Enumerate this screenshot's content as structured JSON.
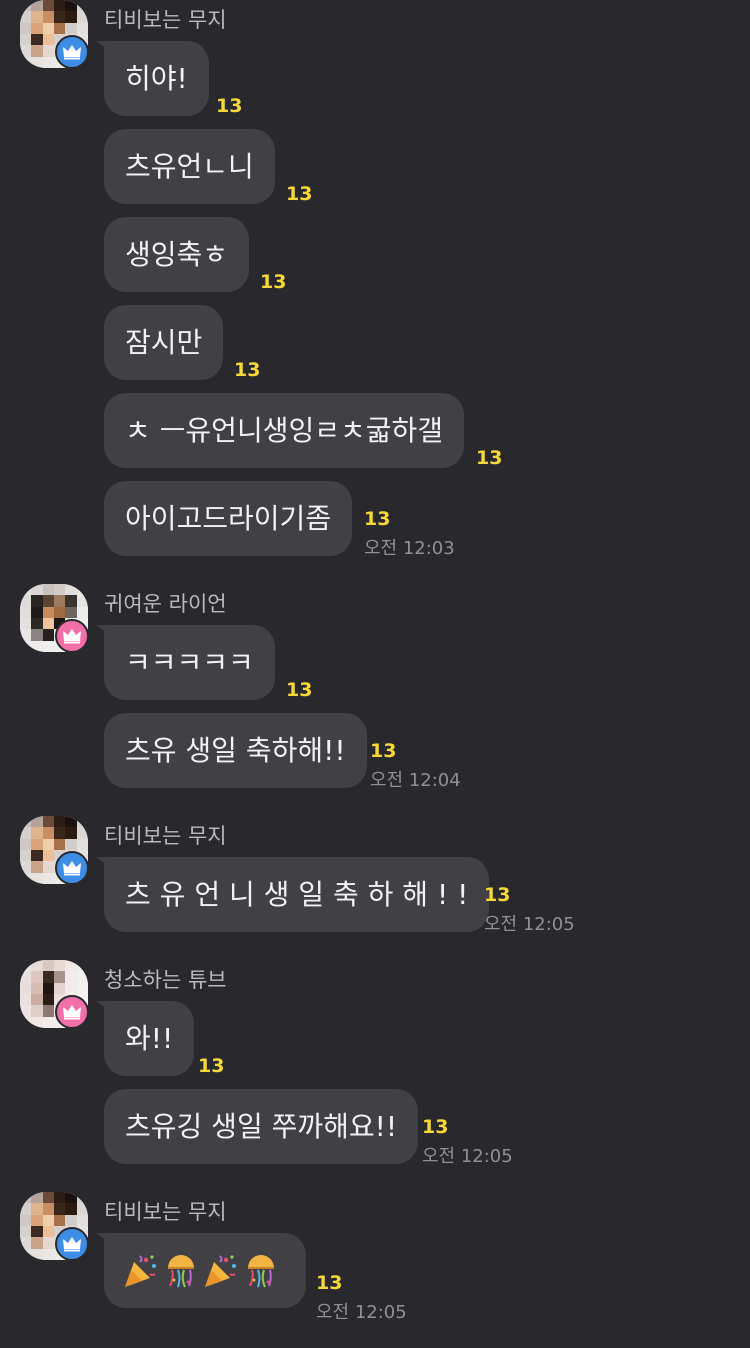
{
  "colors": {
    "background": "#29292d",
    "bubble": "#404045",
    "unread_count": "#f7d836",
    "badge_blue": "#3d8de6",
    "badge_pink": "#f26fa7"
  },
  "groups": [
    {
      "sender": "티비보는 무지",
      "badge": "crown-icon",
      "messages": [
        {
          "text": "히야!",
          "count": "13",
          "time": ""
        },
        {
          "text": "츠유언ㄴ니",
          "count": "13",
          "time": ""
        },
        {
          "text": "생잉축ㅎ",
          "count": "13",
          "time": ""
        },
        {
          "text": "잠시만",
          "count": "13",
          "time": ""
        },
        {
          "text": "ㅊ ㅡ유언니생잉ㄹㅊ굷하갤",
          "count": "13",
          "time": ""
        },
        {
          "text": "아이고드라이기좀",
          "count": "13",
          "time": "오전 12:03"
        }
      ]
    },
    {
      "sender": "귀여운 라이언",
      "badge": "crown-icon",
      "messages": [
        {
          "text": "ㅋㅋㅋㅋㅋ",
          "count": "13",
          "time": ""
        },
        {
          "text": "츠유 생일 축하해!!",
          "count": "13",
          "time": "오전 12:04"
        }
      ]
    },
    {
      "sender": "티비보는 무지",
      "badge": "crown-icon",
      "messages": [
        {
          "text": "츠 유 언 니 생 일 축 하 해 ! !",
          "count": "13",
          "time": "오전 12:05"
        }
      ]
    },
    {
      "sender": "청소하는 튜브",
      "badge": "crown-icon",
      "messages": [
        {
          "text": "와!!",
          "count": "13",
          "time": ""
        },
        {
          "text": "츠유깅 생일 쭈까해요!!",
          "count": "13",
          "time": "오전 12:05"
        }
      ]
    },
    {
      "sender": "티비보는 무지",
      "badge": "crown-icon",
      "messages": [
        {
          "emojis": [
            "party-popper-icon",
            "confetti-ball-icon",
            "party-popper-icon",
            "confetti-ball-icon"
          ],
          "count": "13",
          "time": "오전 12:05"
        }
      ]
    }
  ]
}
